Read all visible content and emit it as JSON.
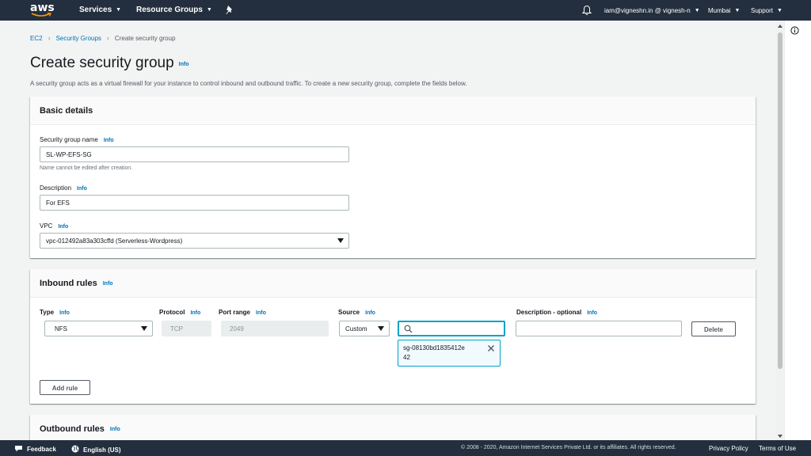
{
  "nav": {
    "logo": "aws",
    "services": "Services",
    "resource_groups": "Resource Groups",
    "account": "iam@vigneshn.in @ vignesh-n",
    "region": "Mumbai",
    "support": "Support"
  },
  "breadcrumb": {
    "ec2": "EC2",
    "security_groups": "Security Groups",
    "current": "Create security group"
  },
  "page": {
    "title": "Create security group",
    "info": "Info",
    "subtitle": "A security group acts as a virtual firewall for your instance to control inbound and outbound traffic. To create a new security group, complete the fields below."
  },
  "basic": {
    "header": "Basic details",
    "name_label": "Security group name",
    "name_value": "SL-WP-EFS-SG",
    "name_hint": "Name cannot be edited after creation.",
    "desc_label": "Description",
    "desc_value": "For EFS",
    "vpc_label": "VPC",
    "vpc_value": "vpc-012492a83a303cffd (Serverless-Wordpress)"
  },
  "inbound": {
    "header": "Inbound rules",
    "col_type": "Type",
    "col_protocol": "Protocol",
    "col_port": "Port range",
    "col_source": "Source",
    "col_desc": "Description - optional",
    "type_value": "NFS",
    "protocol_value": "TCP",
    "port_value": "2049",
    "source_value": "Custom",
    "search_value": "",
    "token_line1": "sg-08130bd1835412e",
    "token_line2": "42",
    "desc_value": "",
    "delete_label": "Delete",
    "add_rule_label": "Add rule"
  },
  "outbound": {
    "header": "Outbound rules"
  },
  "footer": {
    "feedback": "Feedback",
    "language": "English (US)",
    "copyright": "© 2008 - 2020, Amazon Internet Services Private Ltd. or its affiliates. All rights reserved.",
    "privacy": "Privacy Policy",
    "terms": "Terms of Use"
  },
  "colors": {
    "nav_bg": "#232f3e",
    "link": "#0073bb",
    "focus": "#00a1c9",
    "aws_orange": "#ff9900"
  }
}
